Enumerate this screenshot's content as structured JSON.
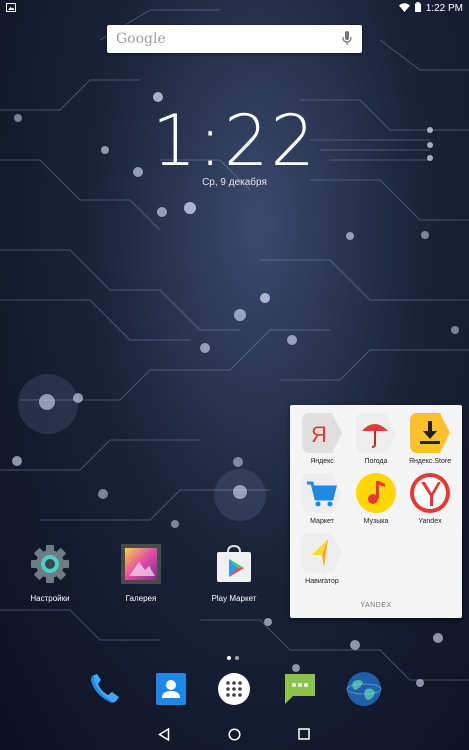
{
  "status": {
    "time": "1:22 PM",
    "icons": [
      "image-icon",
      "wifi-icon",
      "battery-icon"
    ]
  },
  "search": {
    "logo": "Google"
  },
  "clock": {
    "time": "1:22",
    "date": "Ср, 9 декабря"
  },
  "home_apps": [
    {
      "label": "Настройки",
      "icon": "settings-icon"
    },
    {
      "label": "Галерея",
      "icon": "gallery-icon"
    },
    {
      "label": "Play Маркет",
      "icon": "play-store-icon"
    }
  ],
  "folder": {
    "title": "YANDEX",
    "apps": [
      {
        "label": "Яндекс",
        "icon": "yandex-icon"
      },
      {
        "label": "Погода",
        "icon": "weather-icon"
      },
      {
        "label": "Яндекс.Store",
        "icon": "yandex-store-icon"
      },
      {
        "label": "Маркет",
        "icon": "market-cart-icon"
      },
      {
        "label": "Музыка",
        "icon": "music-icon"
      },
      {
        "label": "Yandex",
        "icon": "yandex-browser-icon"
      },
      {
        "label": "Навигатор",
        "icon": "navigator-icon"
      }
    ]
  },
  "dock": [
    "phone-icon",
    "contacts-icon",
    "app-drawer-icon",
    "messaging-icon",
    "browser-icon"
  ],
  "navigation": [
    "back-icon",
    "home-icon",
    "recents-icon"
  ],
  "colors": {
    "folder_bg": "#f5f5f5",
    "wallpaper_line": "#8fa2c8"
  }
}
